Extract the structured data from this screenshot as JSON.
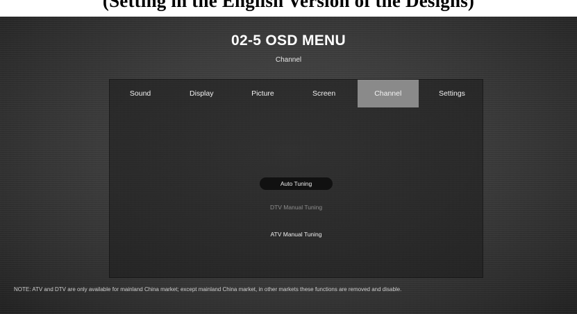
{
  "caption": "(Setting in the English Version of the Designs)",
  "header": {
    "title": "02-5 OSD MENU",
    "subtitle": "Channel"
  },
  "tabs": [
    {
      "label": "Sound"
    },
    {
      "label": "Display"
    },
    {
      "label": "Picture"
    },
    {
      "label": "Screen"
    },
    {
      "label": "Channel",
      "active": true
    },
    {
      "label": "Settings"
    }
  ],
  "options": {
    "auto_tuning": "Auto Tuning",
    "dtv_manual_tuning": "DTV Manual Tuning",
    "atv_manual_tuning": "ATV Manual Tuning"
  },
  "note": "NOTE: ATV and DTV are only available for mainland China market; except mainland China market, in other markets these functions are removed and disable.",
  "colors": {
    "background": "#3a3a3a",
    "active_tab": "#8a8a8a",
    "selected_option": "#111111",
    "disabled_option_text": "#8c8c8c"
  }
}
